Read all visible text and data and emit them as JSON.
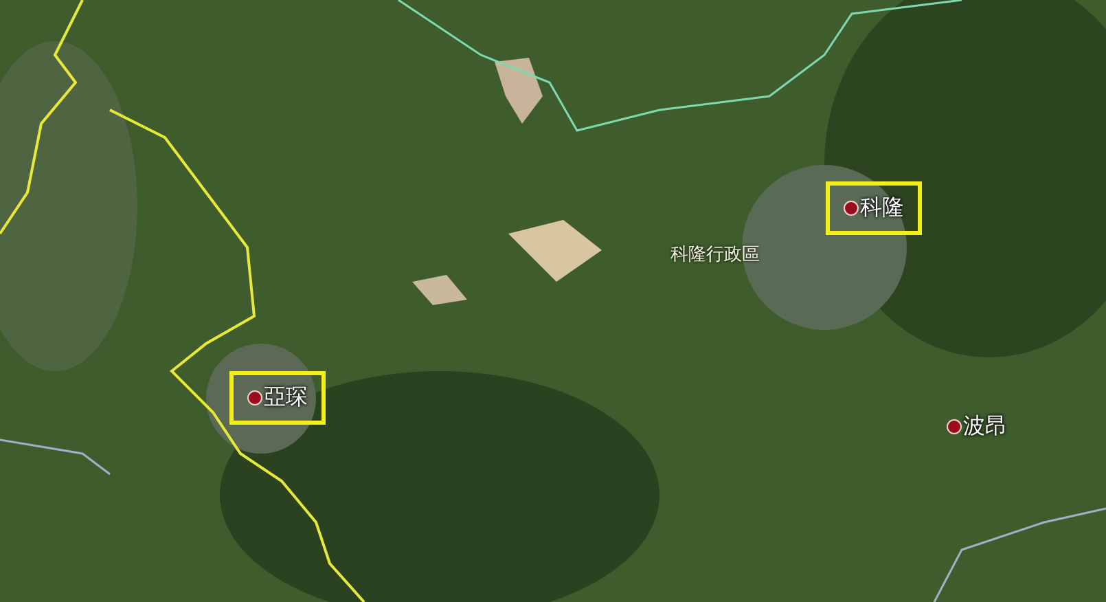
{
  "map": {
    "places": [
      {
        "name": "科隆",
        "highlighted": true
      },
      {
        "name": "亞琛",
        "highlighted": true
      },
      {
        "name": "波昂",
        "highlighted": false
      }
    ],
    "region_label": "科隆行政區"
  }
}
